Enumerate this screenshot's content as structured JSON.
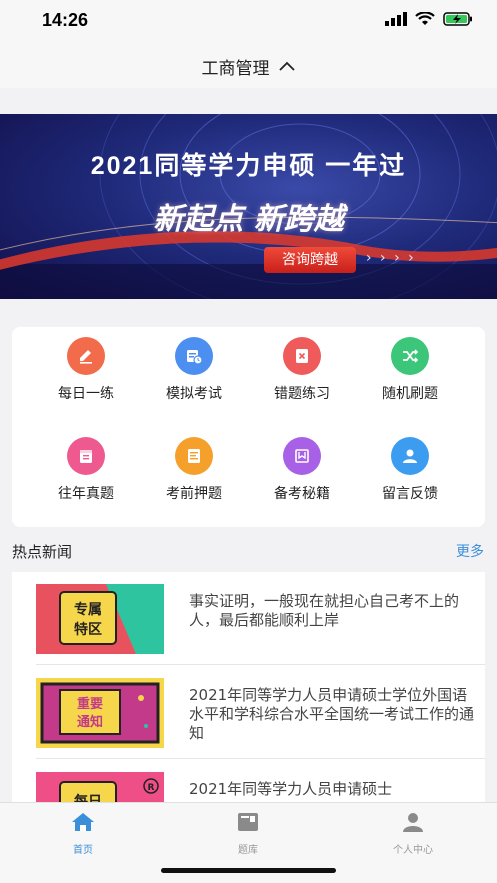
{
  "status": {
    "time": "14:26"
  },
  "nav": {
    "title": "工商管理"
  },
  "banner": {
    "title": "2021同等学力申硕 一年过",
    "slogan": "新起点 新跨越",
    "button": "咨询跨越",
    "arrows": "› › › ›"
  },
  "grid": {
    "items": [
      {
        "label": "每日一练",
        "icon": "pencil-icon",
        "color": "#f26b4a"
      },
      {
        "label": "模拟考试",
        "icon": "exam-clock-icon",
        "color": "#4d8ff0"
      },
      {
        "label": "错题练习",
        "icon": "wrong-doc-icon",
        "color": "#ef5a5a"
      },
      {
        "label": "随机刷题",
        "icon": "shuffle-icon",
        "color": "#3cc67a"
      },
      {
        "label": "往年真题",
        "icon": "calendar-icon",
        "color": "#ee5a8f"
      },
      {
        "label": "考前押题",
        "icon": "notes-icon",
        "color": "#f5a02a"
      },
      {
        "label": "备考秘籍",
        "icon": "book-icon",
        "color": "#a760e6"
      },
      {
        "label": "留言反馈",
        "icon": "user-feedback-icon",
        "color": "#3c9df0"
      }
    ]
  },
  "news": {
    "title": "热点新闻",
    "more": "更多",
    "items": [
      {
        "thumb_text": "专属\n特区",
        "text": "事实证明，一般现在就担心自己考不上的人，最后都能顺利上岸"
      },
      {
        "thumb_text": "重要\n通知",
        "text": "2021年同等学力人员申请硕士学位外国语水平和学科综合水平全国统一考试工作的通知"
      },
      {
        "thumb_text": "每日",
        "text": "2021年同等学力人员申请硕士"
      }
    ]
  },
  "tabs": [
    {
      "label": "首页",
      "active": true
    },
    {
      "label": "题库",
      "active": false
    },
    {
      "label": "个人中心",
      "active": false
    }
  ],
  "colors": {
    "accent": "#3b8fd8",
    "tab_inactive": "#999999"
  }
}
